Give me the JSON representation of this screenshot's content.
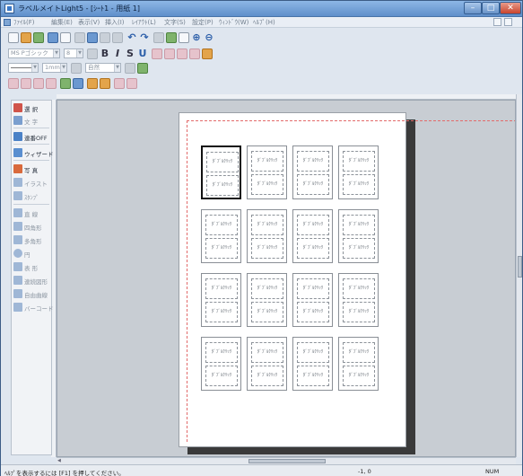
{
  "window": {
    "title": "ラベルメイトLight5 - [ｼｰﾄ1 - 用紙 1]",
    "minimize_glyph": "–",
    "maximize_glyph": "□",
    "close_glyph": "✕"
  },
  "menu": {
    "items": [
      "ﾌｧｲﾙ(F)",
      "編集(E)",
      "表示(V)",
      "挿入(I)",
      "ﾚｲｱｳﾄ(L)",
      "文字(S)",
      "設定(P)",
      "ｳｨﾝﾄﾞｳ(W)",
      "ﾍﾙﾌﾟ(H)"
    ]
  },
  "toolbar": {
    "font_name": "MS Pゴシック",
    "font_size": "8",
    "line_width": "1mm",
    "color_name": "自然",
    "bold_label": "B",
    "italic_label": "I",
    "strike_label": "S",
    "underline_label": "U",
    "undo_glyph": "↶",
    "redo_glyph": "↷",
    "zoom_in_glyph": "⊕",
    "zoom_out_glyph": "⊖"
  },
  "palette": {
    "items": [
      {
        "label": "選 択",
        "icon": "pointer-icon",
        "color": "#d0544a",
        "dim": false
      },
      {
        "label": "文 字",
        "icon": "text-icon",
        "color": "#7b9fcf",
        "dim": true
      },
      {
        "label": "連番OFF",
        "icon": "number-icon",
        "color": "#4b82c7",
        "dim": false
      },
      {
        "label": "ウィザード",
        "icon": "wizard-icon",
        "color": "#5a8fd0",
        "dim": false
      },
      {
        "label": "写 真",
        "icon": "photo-icon",
        "color": "#d96a3c",
        "dim": false
      },
      {
        "label": "イラスト",
        "icon": "illust-icon",
        "color": "#9fb7d6",
        "dim": true
      },
      {
        "label": "ｽﾀﾝﾌﾟ",
        "icon": "stamp-icon",
        "color": "#9fb7d6",
        "dim": true
      },
      {
        "label": "直 線",
        "icon": "line-icon",
        "color": "#9fb7d6",
        "dim": true
      },
      {
        "label": "四角形",
        "icon": "rectangle-icon",
        "color": "#9fb7d6",
        "dim": true
      },
      {
        "label": "多角形",
        "icon": "polygon-icon",
        "color": "#9fb7d6",
        "dim": true
      },
      {
        "label": "円",
        "icon": "circle-icon",
        "color": "#9fb7d6",
        "dim": true
      },
      {
        "label": "表 形",
        "icon": "table-icon",
        "color": "#9fb7d6",
        "dim": true
      },
      {
        "label": "連続図形",
        "icon": "polyline-icon",
        "color": "#9fb7d6",
        "dim": true
      },
      {
        "label": "自由曲線",
        "icon": "freehand-icon",
        "color": "#9fb7d6",
        "dim": true
      },
      {
        "label": "バーコード",
        "icon": "barcode-icon",
        "color": "#9fb7d6",
        "dim": true
      }
    ]
  },
  "labels": {
    "field_text": "ﾀﾞﾌﾞﾙｸﾘｯｸ",
    "rows": 4,
    "cols": 4,
    "selected": {
      "row": 0,
      "col": 0
    }
  },
  "status": {
    "hint": "ﾍﾙﾌﾟを表示するには [F1] を押してください。",
    "coords": "-1,  0",
    "num": "NUM"
  }
}
